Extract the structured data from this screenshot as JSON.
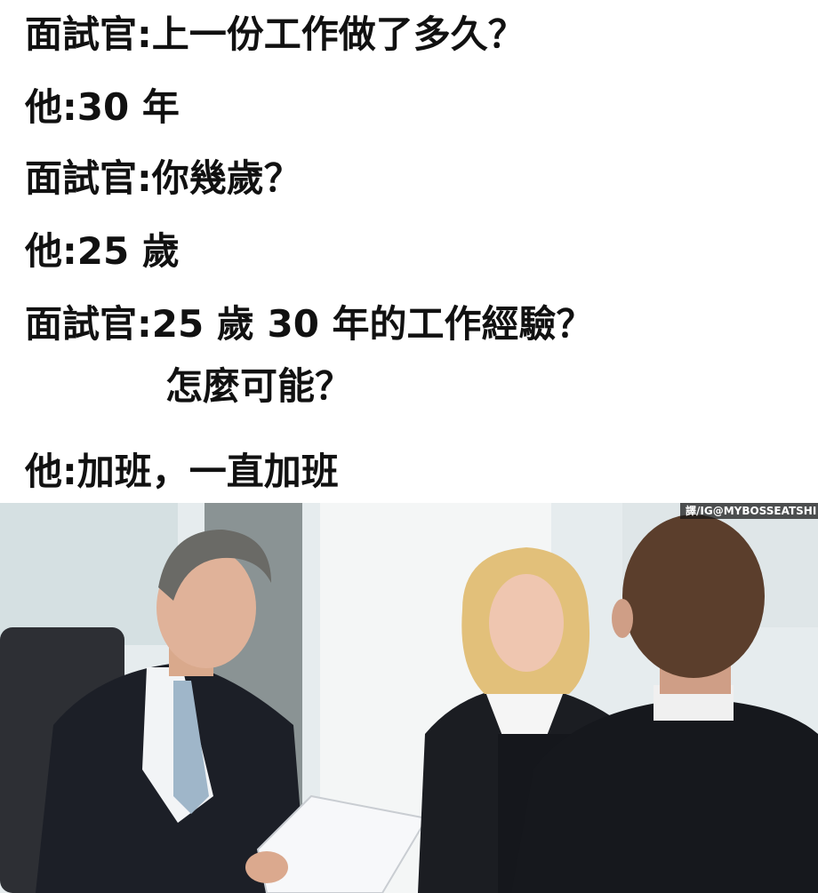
{
  "dialogue": [
    {
      "speaker": "面試官:",
      "text": "上一份工作做了多久？"
    },
    {
      "speaker": "他:",
      "text": "30 年"
    },
    {
      "speaker": "面試官:",
      "text": "你幾歲？"
    },
    {
      "speaker": "他:",
      "text": "25 歲"
    },
    {
      "speaker": "面試官:",
      "text": "25 歲 30 年的工作經驗？"
    },
    {
      "speaker": "",
      "text": "怎麼可能？"
    },
    {
      "speaker": "他:",
      "text": "加班，一直加班"
    }
  ],
  "photo": {
    "watermark": "譯/IG@MYBOSSEATSHI"
  },
  "colors": {
    "text": "#111111",
    "background": "#ffffff",
    "suit": "#1a1c22",
    "wall": "#e9eef0"
  }
}
